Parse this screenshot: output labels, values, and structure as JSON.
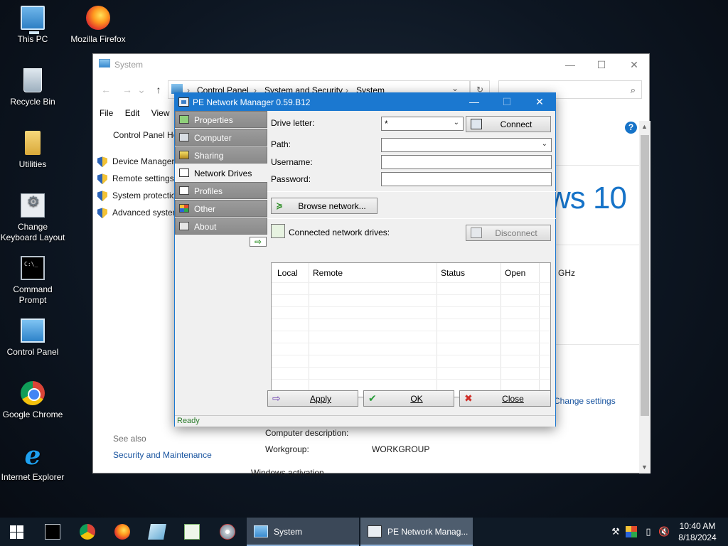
{
  "desktop": {
    "icons": [
      {
        "label": "This PC",
        "icon": "this-pc-icon"
      },
      {
        "label": "Mozilla Firefox",
        "icon": "firefox-icon"
      },
      {
        "label": "Recycle Bin",
        "icon": "recycle-bin-icon"
      },
      {
        "label": "Utilities",
        "icon": "folder-icon"
      },
      {
        "label": "Change Keyboard Layout",
        "icon": "keyboard-settings-icon"
      },
      {
        "label": "Command Prompt",
        "icon": "command-prompt-icon"
      },
      {
        "label": "Control Panel",
        "icon": "control-panel-icon"
      },
      {
        "label": "Google Chrome",
        "icon": "chrome-icon"
      },
      {
        "label": "Internet Explorer",
        "icon": "internet-explorer-icon"
      }
    ]
  },
  "system_window": {
    "title": "System",
    "breadcrumb": [
      "Control Panel",
      "System and Security",
      "System"
    ],
    "menu": [
      "File",
      "Edit",
      "View"
    ],
    "control_panel_home": "Control Panel Ho",
    "left_links": [
      "Device Manager",
      "Remote settings",
      "System protectio",
      "Advanced system"
    ],
    "windows_logo_text": "ws 10",
    "ghz_text": "GHz",
    "change_settings": "Change settings",
    "see_also": "See also",
    "security_link": "Security and Maintenance",
    "computer_description_label": "Computer description:",
    "workgroup_label": "Workgroup:",
    "workgroup_value": "WORKGROUP",
    "windows_activation": "Windows activation"
  },
  "pe_dialog": {
    "title": "PE Network Manager 0.59.B12",
    "nav": [
      {
        "label": "Properties",
        "icon": "properties-icon"
      },
      {
        "label": "Computer",
        "icon": "computer-icon"
      },
      {
        "label": "Sharing",
        "icon": "sharing-icon"
      },
      {
        "label": "Network Drives",
        "icon": "network-drives-icon",
        "active": true
      },
      {
        "label": "Profiles",
        "icon": "profiles-icon"
      },
      {
        "label": "Other",
        "icon": "other-icon"
      },
      {
        "label": "About",
        "icon": "about-icon"
      }
    ],
    "drive_letter_label": "Drive letter:",
    "drive_letter_value": "*",
    "path_label": "Path:",
    "path_value": "",
    "username_label": "Username:",
    "password_label": "Password:",
    "connect_label": "Connect",
    "browse_label": "Browse network...",
    "connected_label": "Connected network drives:",
    "disconnect_label": "Disconnect",
    "grid_columns": [
      "Local",
      "Remote",
      "Status",
      "Open"
    ],
    "apply_label": "Apply",
    "ok_label": "OK",
    "close_label": "Close",
    "status_text": "Ready"
  },
  "taskbar": {
    "tasks": [
      {
        "label": "System",
        "icon": "system-window-icon"
      },
      {
        "label": "PE Network Manag...",
        "icon": "pe-network-manager-icon"
      }
    ],
    "clock_time": "10:40 AM",
    "clock_date": "8/18/2024"
  },
  "colors": {
    "accent": "#1b78d0",
    "link": "#1a55a0",
    "status_green": "#2d7d2d"
  }
}
